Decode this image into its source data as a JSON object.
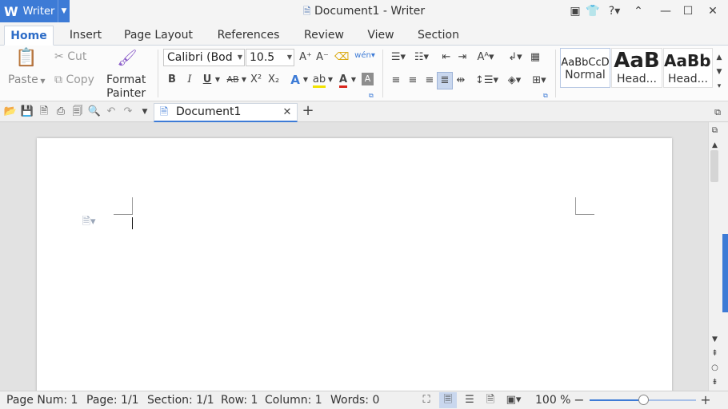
{
  "app": {
    "name": "Writer",
    "title": "Document1 - Writer"
  },
  "tabs": [
    "Home",
    "Insert",
    "Page Layout",
    "References",
    "Review",
    "View",
    "Section"
  ],
  "clipboard": {
    "paste": "Paste",
    "cut": "Cut",
    "copy": "Copy",
    "format_painter_1": "Format",
    "format_painter_2": "Painter"
  },
  "font": {
    "name": "Calibri (Bod",
    "size": "10.5"
  },
  "styles": [
    {
      "preview": "AaBbCcD",
      "name": "Normal"
    },
    {
      "preview": "AaB",
      "name": "Head..."
    },
    {
      "preview": "AaBb(",
      "name": "Head..."
    }
  ],
  "format_labels": {
    "bold": "B",
    "italic": "I",
    "underline": "U",
    "strike": "AB",
    "superscript": "X²",
    "subscript": "X₂",
    "wen": "wén"
  },
  "document_tab": {
    "label": "Document1"
  },
  "status": {
    "page_num": "Page Num: 1",
    "page": "Page: 1/1",
    "section": "Section: 1/1",
    "row": "Row: 1",
    "column": "Column: 1",
    "words": "Words: 0",
    "zoom": "100 %",
    "zoom_level": 0.5
  },
  "colors": {
    "accent": "#3d7bd6",
    "highlight": "#f2e200",
    "font_color": "#d9261c"
  }
}
